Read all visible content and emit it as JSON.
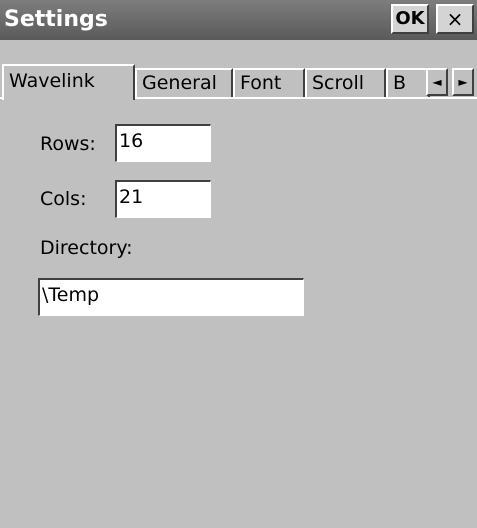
{
  "window": {
    "title": "Settings",
    "ok_label": "OK",
    "close_label": "×"
  },
  "tabs": [
    {
      "label": "Wavelink",
      "active": true
    },
    {
      "label": "General",
      "active": false
    },
    {
      "label": "Font",
      "active": false
    },
    {
      "label": "Scroll",
      "active": false
    },
    {
      "label": "B",
      "active": false
    }
  ],
  "tab_scroll": {
    "left_icon": "◄",
    "right_icon": "►"
  },
  "form": {
    "rows_label": "Rows:",
    "rows_value": "16",
    "cols_label": "Cols:",
    "cols_value": "21",
    "directory_label": "Directory:",
    "directory_value": "\\Temp"
  }
}
